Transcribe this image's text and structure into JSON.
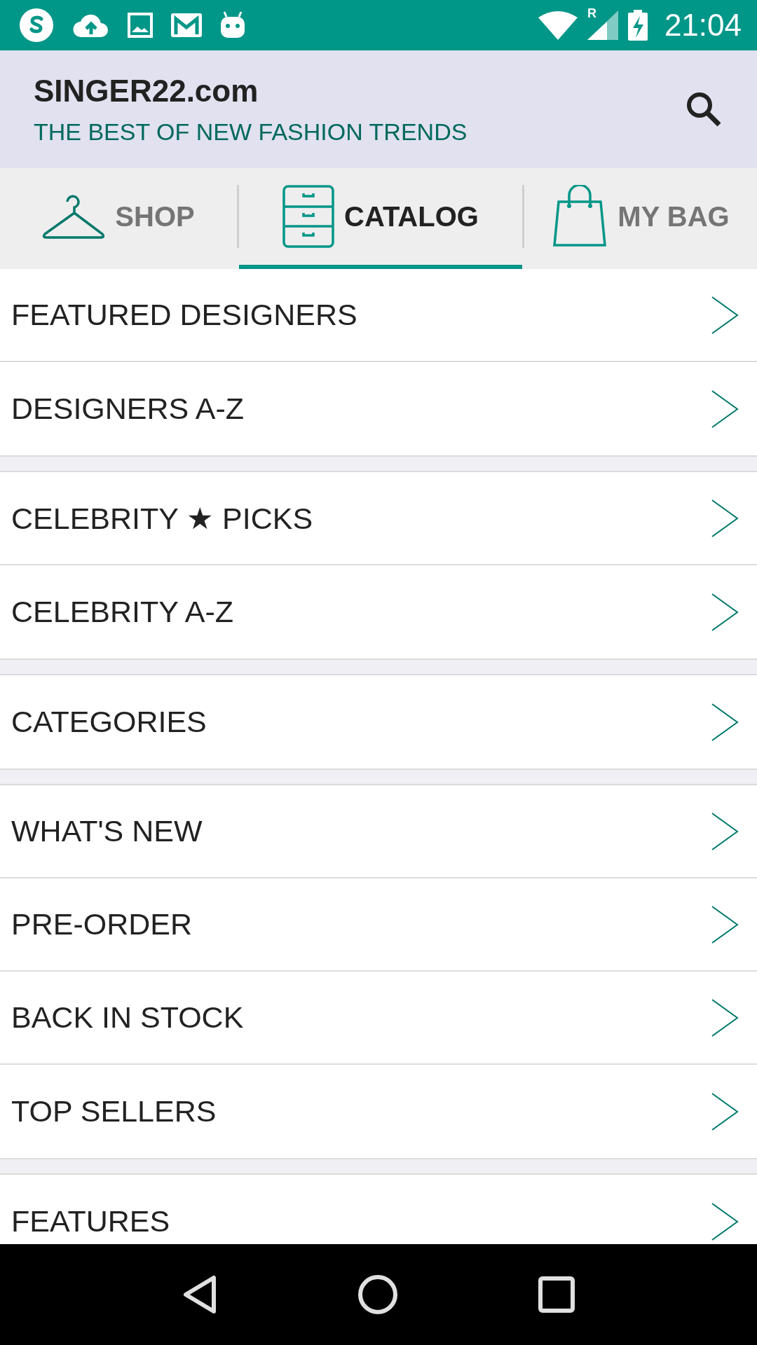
{
  "status_bar": {
    "network_label": "R",
    "time": "21:04"
  },
  "header": {
    "title": "SINGER22.com",
    "subtitle": "THE BEST OF NEW FASHION TRENDS"
  },
  "tabs": [
    {
      "label": "SHOP",
      "selected": false
    },
    {
      "label": "CATALOG",
      "selected": true
    },
    {
      "label": "MY BAG",
      "selected": false
    }
  ],
  "menu_groups": [
    {
      "items": [
        {
          "label": "FEATURED DESIGNERS"
        },
        {
          "label": "DESIGNERS A-Z"
        }
      ]
    },
    {
      "items": [
        {
          "label": "CELEBRITY ★ PICKS"
        },
        {
          "label": "CELEBRITY A-Z"
        }
      ]
    },
    {
      "items": [
        {
          "label": "CATEGORIES"
        }
      ]
    },
    {
      "items": [
        {
          "label": "WHAT'S NEW"
        },
        {
          "label": "PRE-ORDER"
        },
        {
          "label": "BACK IN STOCK"
        },
        {
          "label": "TOP SELLERS"
        }
      ]
    },
    {
      "items": [
        {
          "label": "FEATURES"
        }
      ]
    }
  ]
}
